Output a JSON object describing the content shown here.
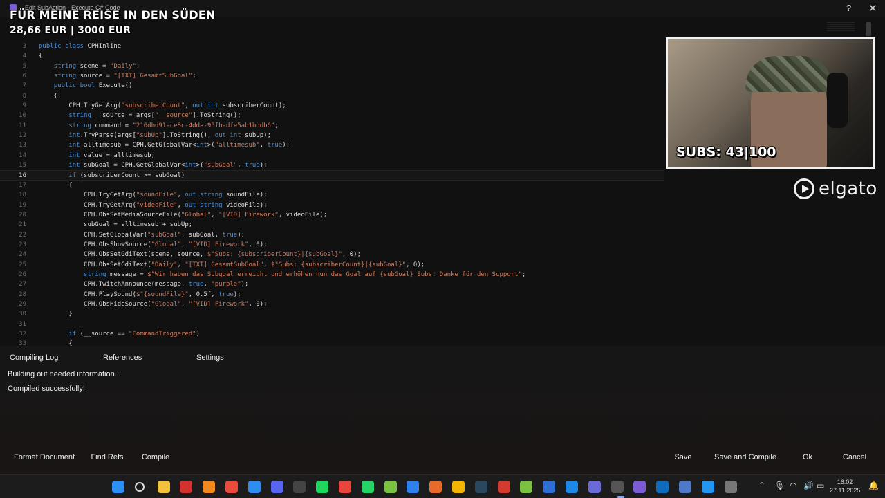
{
  "window": {
    "title": "Edit SubAction - Execute C# Code",
    "help": "?",
    "close": "✕"
  },
  "overlay": {
    "title": "FÜR MEINE REISE IN DEN SÜDEN",
    "goal": "28,66 EUR | 3000 EUR"
  },
  "webcam": {
    "subs": "SUBS: 43|100"
  },
  "brand": {
    "name": "elgato"
  },
  "editor": {
    "current_line": "16",
    "lines": [
      {
        "n": "3",
        "code": "public class CPHInline"
      },
      {
        "n": "4",
        "code": "{"
      },
      {
        "n": "5",
        "code": "    string scene = \"Daily\";"
      },
      {
        "n": "6",
        "code": "    string source = \"[TXT] GesamtSubGoal\";"
      },
      {
        "n": "7",
        "code": "    public bool Execute()"
      },
      {
        "n": "8",
        "code": "    {"
      },
      {
        "n": "9",
        "code": "        CPH.TryGetArg(\"subscriberCount\", out int subscriberCount);"
      },
      {
        "n": "10",
        "code": "        string __source = args[\"__source\"].ToString();"
      },
      {
        "n": "11",
        "code": "        string command = \"216dbd91-ce8c-4dda-95fb-dfe5ab1bddb6\";"
      },
      {
        "n": "12",
        "code": "        int.TryParse(args[\"subUp\"].ToString(), out int subUp);"
      },
      {
        "n": "13",
        "code": "        int alltimesub = CPH.GetGlobalVar<int>(\"alltimesub\", true);"
      },
      {
        "n": "14",
        "code": "        int value = alltimesub;"
      },
      {
        "n": "15",
        "code": "        int subGoal = CPH.GetGlobalVar<int>(\"subGoal\", true);"
      },
      {
        "n": "16",
        "code": "        if (subscriberCount >= subGoal)"
      },
      {
        "n": "17",
        "code": "        {"
      },
      {
        "n": "18",
        "code": "            CPH.TryGetArg(\"soundFile\", out string soundFile);"
      },
      {
        "n": "19",
        "code": "            CPH.TryGetArg(\"videoFile\", out string videoFile);"
      },
      {
        "n": "20",
        "code": "            CPH.ObsSetMediaSourceFile(\"Global\", \"[VID] Firework\", videoFile);"
      },
      {
        "n": "21",
        "code": "            subGoal = alltimesub + subUp;"
      },
      {
        "n": "22",
        "code": "            CPH.SetGlobalVar(\"subGoal\", subGoal, true);"
      },
      {
        "n": "23",
        "code": "            CPH.ObsShowSource(\"Global\", \"[VID] Firework\", 0);"
      },
      {
        "n": "24",
        "code": "            CPH.ObsSetGdiText(scene, source, $\"Subs: {subscriberCount}|{subGoal}\", 0);"
      },
      {
        "n": "25",
        "code": "            CPH.ObsSetGdiText(\"Daily\", \"[TXT] GesamtSubGoal\", $\"Subs: {subscriberCount}|{subGoal}\", 0);"
      },
      {
        "n": "26",
        "code": "            string message = $\"Wir haben das Subgoal erreicht und erhöhen nun das Goal auf {subGoal} Subs! Danke für den Support\";"
      },
      {
        "n": "27",
        "code": "            CPH.TwitchAnnounce(message, true, \"purple\");"
      },
      {
        "n": "28",
        "code": "            CPH.PlaySound($\"{soundFile}\", 0.5f, true);"
      },
      {
        "n": "29",
        "code": "            CPH.ObsHideSource(\"Global\", \"[VID] Firework\", 0);"
      },
      {
        "n": "30",
        "code": "        }"
      },
      {
        "n": "31",
        "code": ""
      },
      {
        "n": "32",
        "code": "        if (__source == \"CommandTriggered\")"
      },
      {
        "n": "33",
        "code": "        {"
      }
    ]
  },
  "panel": {
    "tabs": [
      "Compiling Log",
      "References",
      "Settings"
    ],
    "log": [
      "Building out needed information...",
      "Compiled successfully!"
    ]
  },
  "buttons": {
    "format": "Format Document",
    "find_refs": "Find Refs",
    "compile": "Compile",
    "save": "Save",
    "save_compile": "Save and Compile",
    "ok": "Ok",
    "cancel": "Cancel"
  },
  "taskbar": {
    "time": "16:02",
    "date": "27.11.2025",
    "icons": [
      "windows",
      "search",
      "file-explorer",
      "filezilla",
      "vlc",
      "chrome",
      "chrome-alt",
      "discord",
      "epic-games",
      "spotify",
      "git",
      "whatsapp",
      "notepad-plus",
      "vscode",
      "affinity",
      "app-r",
      "steam",
      "app-box",
      "streamerbot",
      "app-cube",
      "app-blue",
      "app-tools",
      "obs",
      "streamer-bot-active",
      "app-x",
      "app-audio",
      "app-store",
      "app-arrow"
    ],
    "icon_colors": [
      "#2b8ff5",
      "#ddd",
      "#f2c23c",
      "#d43131",
      "#f18a1d",
      "#e94b3c",
      "#2f8cf0",
      "#5865f2",
      "#444",
      "#1ed760",
      "#e8453c",
      "#25d366",
      "#7cc242",
      "#2f80ed",
      "#e86a2a",
      "#f4b400",
      "#2a475e",
      "#d33b2f",
      "#7cc242",
      "#2d6fd2",
      "#1e88e5",
      "#6a6ad8",
      "#555",
      "#7b5bd6",
      "#0f6cbd",
      "#5078c8",
      "#2196f3",
      "#777"
    ]
  }
}
